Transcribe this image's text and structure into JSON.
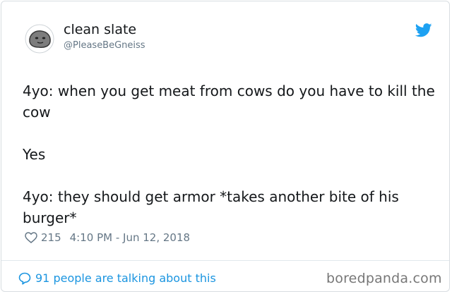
{
  "tweet": {
    "display_name": "clean slate",
    "handle": "@PleaseBeGneiss",
    "lines": [
      "4yo: when you get meat from cows do you have to kill the cow",
      "Yes",
      "4yo: they should get armor *takes another bite of his burger*"
    ],
    "likes": "215",
    "timestamp": "4:10 PM - Jun 12, 2018",
    "talking": "91 people are talking about this"
  },
  "watermark": "boredpanda.com",
  "colors": {
    "accent": "#1b95e0",
    "muted": "#657786",
    "twitter_blue": "#1da1f2"
  },
  "icons": {
    "avatar": "rock-face-avatar",
    "brand": "twitter-bird-icon",
    "like": "heart-outline-icon",
    "reply": "speech-bubble-icon"
  }
}
